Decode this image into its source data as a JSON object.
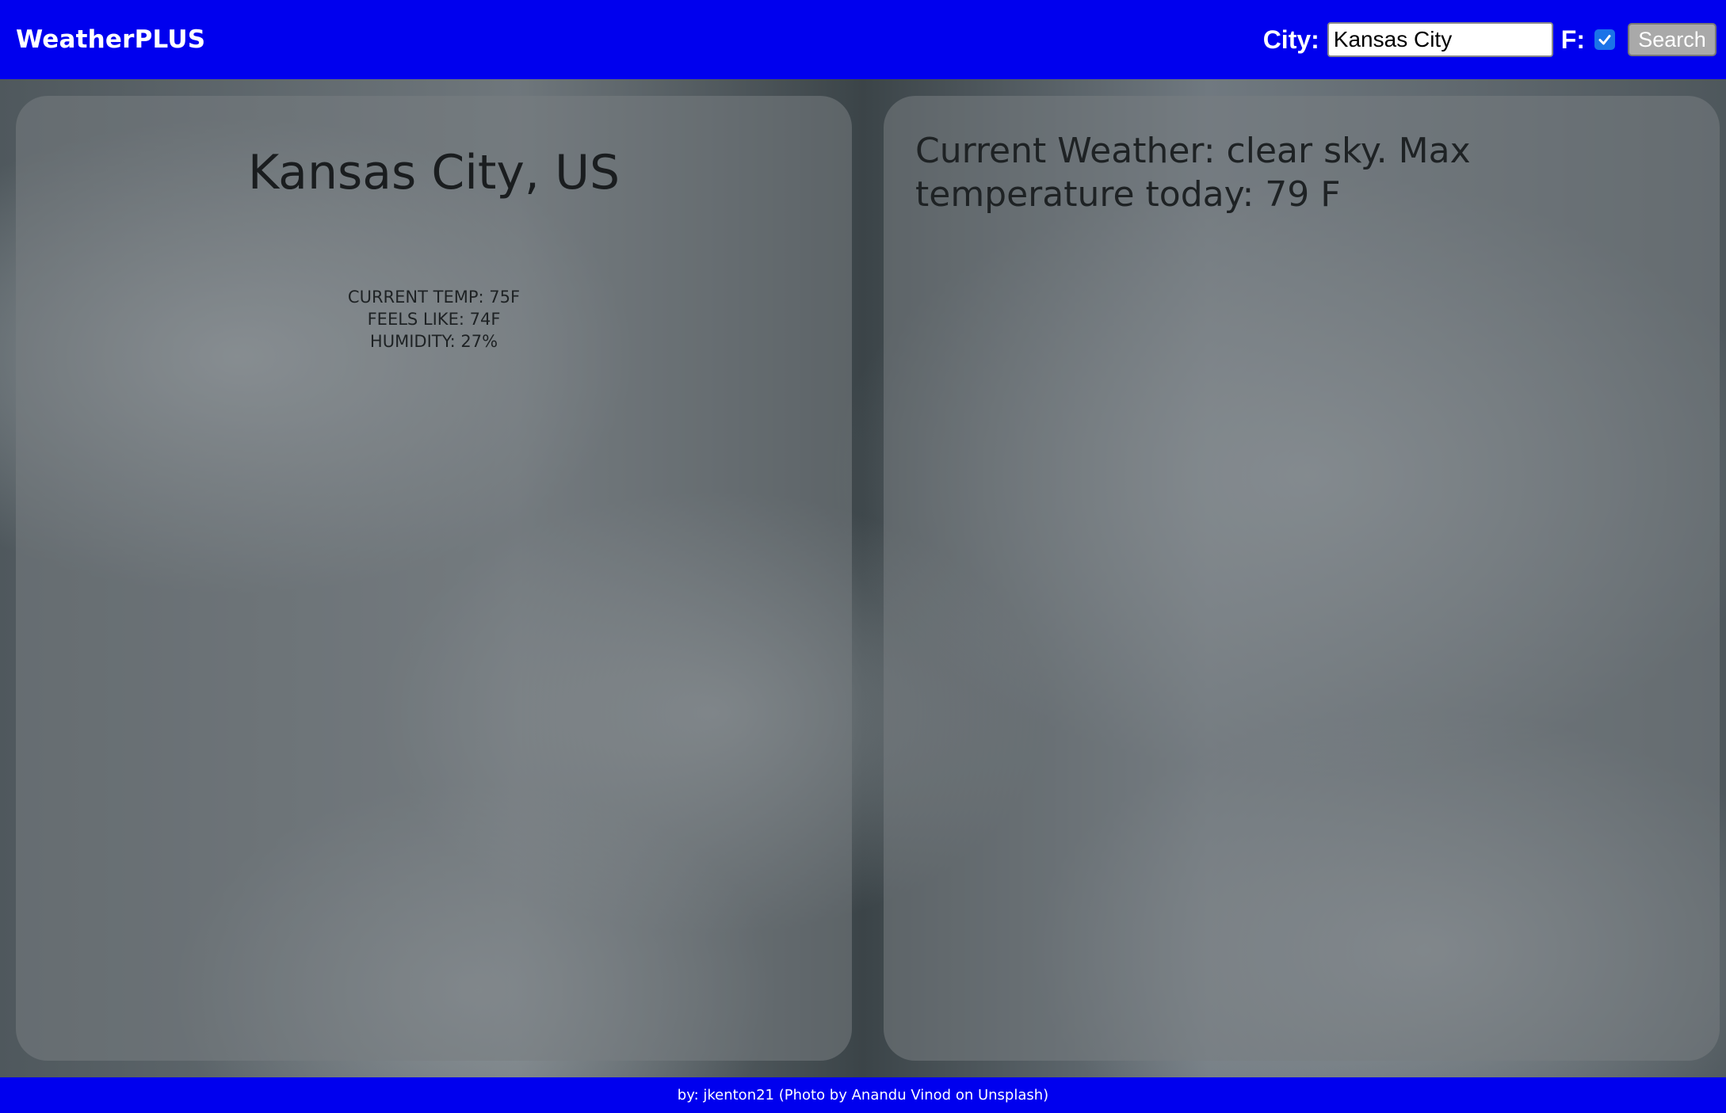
{
  "header": {
    "brand": "WeatherPLUS",
    "city_label": "City:",
    "city_value": "Kansas City",
    "fahrenheit_label": "F:",
    "fahrenheit_checked": true,
    "search_label": "Search"
  },
  "location_card": {
    "city": "Kansas City, US",
    "current_temp": "CURRENT TEMP: 75F",
    "feels_like": "FEELS LIKE: 74F",
    "humidity": "HUMIDITY: 27%"
  },
  "forecast_card": {
    "summary": "Current Weather: clear sky. Max temperature today: 79 F"
  },
  "footer": {
    "credit": "by: jkenton21 (Photo by Anandu Vinod on Unsplash)"
  },
  "colors": {
    "header_bg": "#0000ee",
    "checkbox_accent": "#1a73e8"
  },
  "icons": {
    "checkbox": "check-icon"
  }
}
